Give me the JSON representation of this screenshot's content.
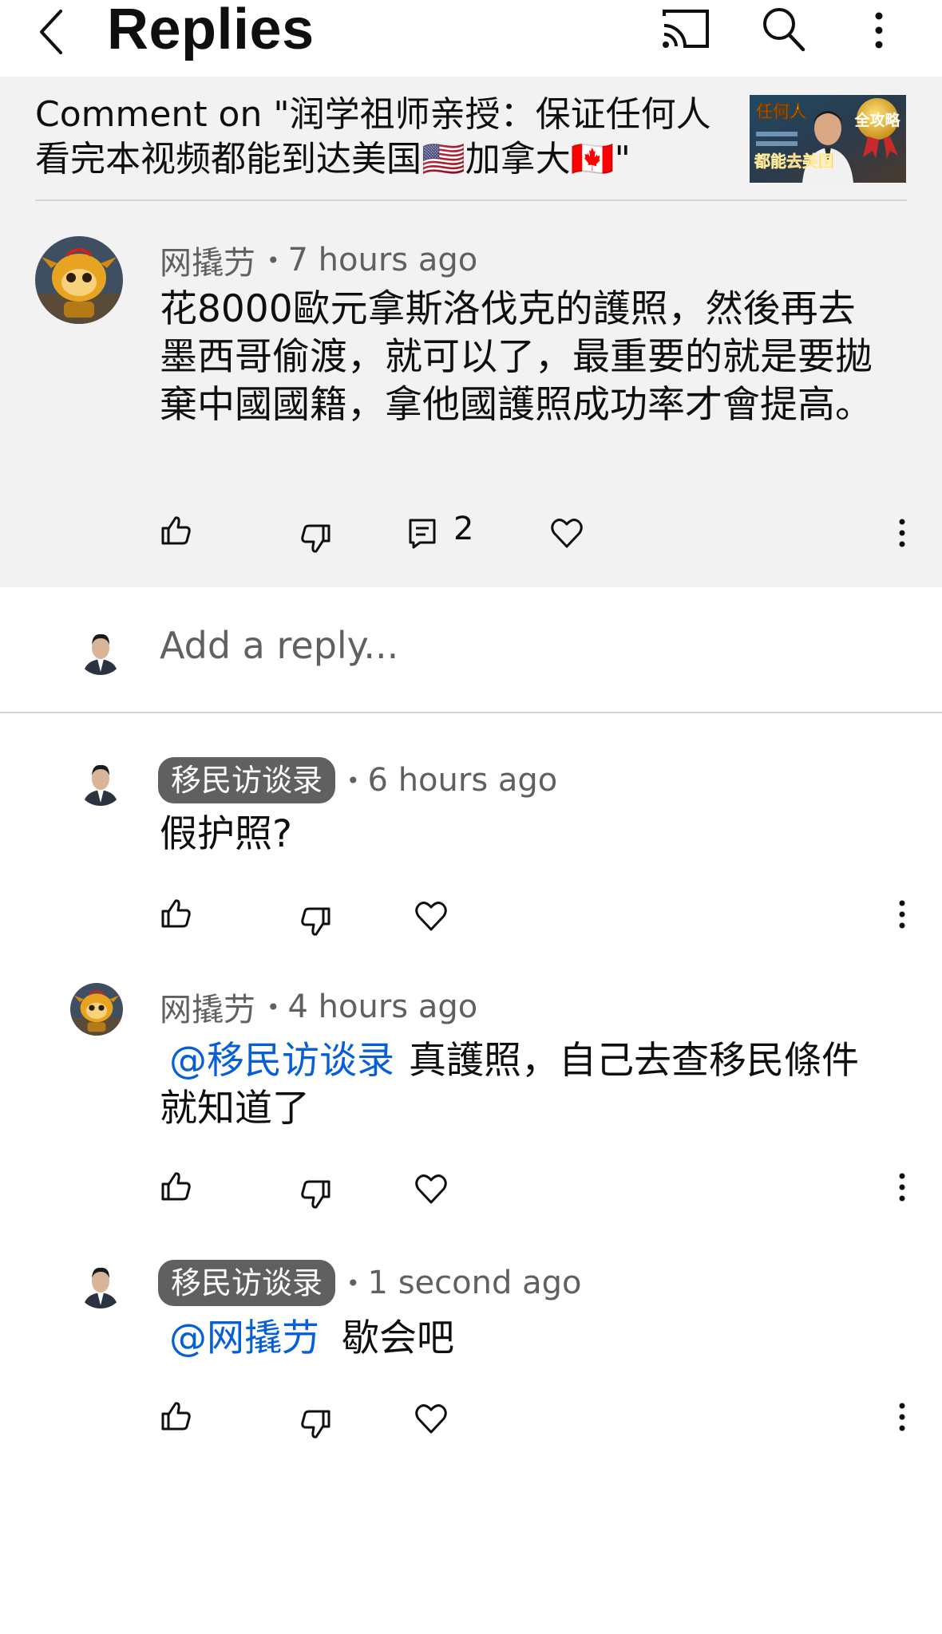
{
  "header": {
    "title": "Replies",
    "icons": [
      "back-icon",
      "cast-icon",
      "search-icon",
      "more-vertical-icon"
    ]
  },
  "video": {
    "comment_on_line1": "Comment on \"润学祖师亲授：保证任何人",
    "comment_on_line2": "看完本视频都能到达美国🇺🇸加拿大🇨🇦\"",
    "thumbnail_texts": [
      "任何人",
      "全攻略",
      "都能去美国"
    ]
  },
  "top_comment": {
    "author": "网撬芀",
    "time": "7 hours ago",
    "text": "花8000歐元拿斯洛伐克的護照，然後再去墨西哥偷渡，就可以了，最重要的就是要拋棄中國國籍，拿他國護照成功率才會提高。",
    "reply_count": "2"
  },
  "add_reply": {
    "placeholder": "Add a reply..."
  },
  "replies": [
    {
      "author": "移民访谈录",
      "time": "6 hours ago",
      "mention": "",
      "text": "假护照?"
    },
    {
      "author": "网撬芀",
      "time": "4 hours ago",
      "mention": "@移民访谈录",
      "text": "真護照，自己去查移民條件就知道了"
    },
    {
      "author": "移民访谈录",
      "time": "1 second ago",
      "mention": "@网撬芀",
      "text": "歇会吧"
    }
  ],
  "colors": {
    "panel_bg": "#f2f2f2",
    "mention_blue": "#065fd4",
    "meta_gray": "#606060",
    "author_pill_bg": "#606060"
  }
}
